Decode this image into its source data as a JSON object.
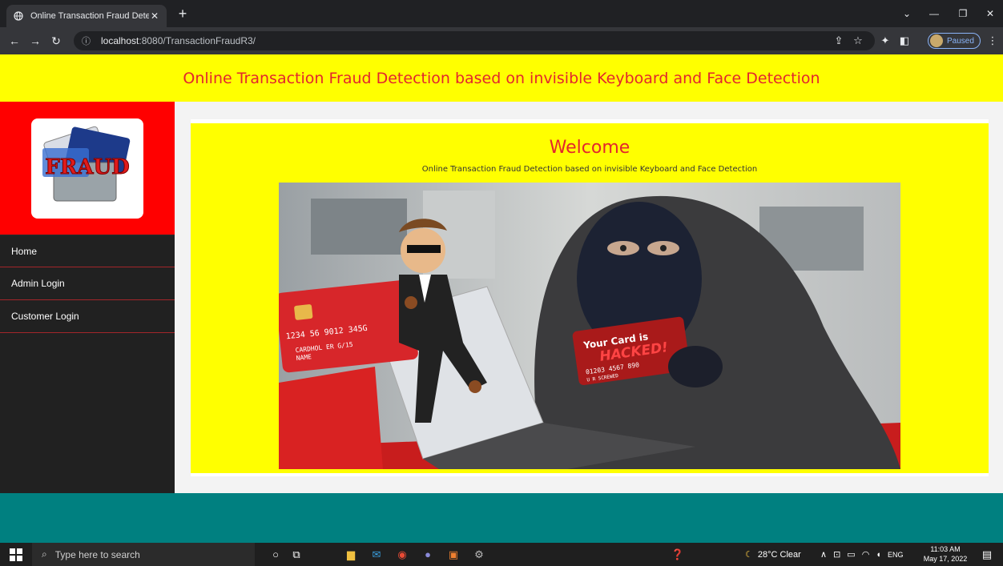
{
  "browser": {
    "tab_title": "Online Transaction Fraud Detectio",
    "new_tab": "+",
    "url_host": "localhost",
    "url_rest": ":8080/TransactionFraudR3/",
    "profile_status": "Paused"
  },
  "header": {
    "title": "Online Transaction Fraud Detection based on invisible Keyboard and Face Detection"
  },
  "sidebar": {
    "logo_text": "FRAUD",
    "items": [
      {
        "label": "Home"
      },
      {
        "label": "Admin Login"
      },
      {
        "label": "Customer Login"
      }
    ]
  },
  "main": {
    "welcome": "Welcome",
    "subtitle": "Online Transaction Fraud Detection based on invisible Keyboard and Face Detection",
    "hero": {
      "card_left_number": "1234 56   9012 345G",
      "card_left_holder": "CARDHOL  ER  G/15",
      "card_left_name": "NAME",
      "card_right_line1": "Your Card is",
      "card_right_line2": "HACKED!",
      "card_right_number": "01203 4567 890",
      "card_right_name": "U R SCREWED"
    }
  },
  "taskbar": {
    "search_placeholder": "Type here to search",
    "weather": "28°C  Clear",
    "language": "ENG",
    "time": "11:03 AM",
    "date": "May 17, 2022"
  },
  "colors": {
    "header_bg": "#ffff00",
    "title_red": "#e3262d",
    "sidebar_bg": "#212121",
    "logo_bg": "#ff0000",
    "footer_teal": "#008080"
  }
}
